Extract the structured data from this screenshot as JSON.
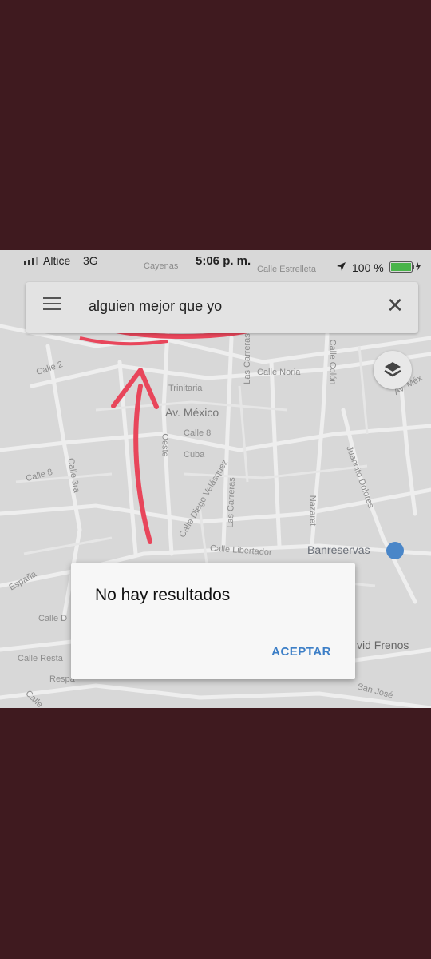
{
  "status_bar": {
    "carrier": "Altice",
    "network": "3G",
    "time": "5:06 p. m.",
    "battery": "100 %"
  },
  "search": {
    "query": "alguien mejor que yo"
  },
  "icons": {
    "menu": "hamburger-menu-icon",
    "close": "close-icon",
    "layers": "layers-icon"
  },
  "map_labels": {
    "cayenas": "Cayenas",
    "calle_estrelleta": "Calle Estrelleta",
    "calle_2": "Calle 2",
    "las_carreras_top": "Las Carreras",
    "calle_noria": "Calle Noria",
    "calle_colon": "Calle Colón",
    "trinitaria": "Trinitaria",
    "av_mexico": "Av. México",
    "av_mexico_right": "Av. Méx",
    "calle_8_center": "Calle 8",
    "cuba": "Cuba",
    "oeste": "Oeste",
    "calle_8_left": "Calle 8",
    "calle_3ra": "Calle 3ra",
    "calle_diego_velazquez": "Calle Diego Velásquez",
    "las_carreras": "Las Carreras",
    "nazaret": "Nazaret",
    "juancito_dolores": "Juancito Dolores",
    "calle_libertador": "Calle Libertador",
    "banreservas": "Banreservas",
    "espana": "España",
    "calle_d": "Calle D",
    "calle_resta": "Calle Resta",
    "respa": "Respa",
    "calle_bottom": "Calle",
    "vid_frenos": "vid Frenos",
    "san_jose": "San José"
  },
  "dialog": {
    "title": "No hay resultados",
    "button": "ACEPTAR"
  },
  "colors": {
    "annotation": "#e8465b",
    "dialog_button": "#3d7fc7",
    "frame_background": "#3f1a1f"
  }
}
